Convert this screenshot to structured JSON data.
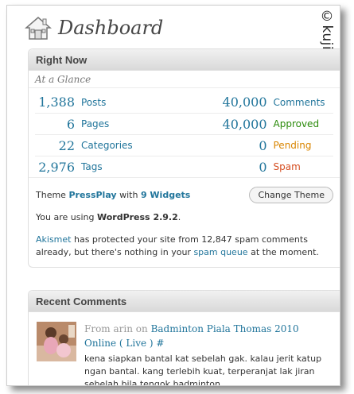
{
  "page": {
    "title": "Dashboard",
    "watermark": "©kujie"
  },
  "right_now": {
    "heading": "Right Now",
    "at_a_glance": "At a Glance",
    "rows": [
      {
        "left_num": "1,388",
        "left_label": "Posts",
        "right_num": "40,000",
        "right_label": "Comments"
      },
      {
        "left_num": "6",
        "left_label": "Pages",
        "right_num": "40,000",
        "right_label": "Approved"
      },
      {
        "left_num": "22",
        "left_label": "Categories",
        "right_num": "0",
        "right_label": "Pending"
      },
      {
        "left_num": "2,976",
        "left_label": "Tags",
        "right_num": "0",
        "right_label": "Spam"
      }
    ],
    "theme_prefix": "Theme",
    "theme_name": "PressPlay",
    "theme_with": "with",
    "widgets_link": "9 Widgets",
    "change_theme_button": "Change Theme",
    "version_prefix": "You are using",
    "version": "WordPress 2.9.2",
    "version_suffix": ".",
    "akismet_link": "Akismet",
    "akismet_text1": " has protected your site from 12,847 spam comments already, but there's nothing in your ",
    "spam_queue_link": "spam queue",
    "akismet_text2": " at the moment."
  },
  "recent_comments": {
    "heading": "Recent Comments",
    "items": [
      {
        "from_prefix": "From",
        "author": "arin",
        "on": "on",
        "post_title": "Badminton Piala Thomas 2010 Online ( Live ) #",
        "excerpt": "kena siapkan bantal kat sebelah gak. kalau jerit katup ngan bantal. kang terlebih kuat, terperanjat lak jiran sebelah.bila tengok badminton ..."
      }
    ]
  },
  "colors": {
    "link": "#21759b",
    "approved": "#2a8a0a",
    "pending": "#d98500",
    "spam": "#d54e21"
  },
  "icons": {
    "header": "home-icon",
    "avatar": "avatar-photo"
  }
}
